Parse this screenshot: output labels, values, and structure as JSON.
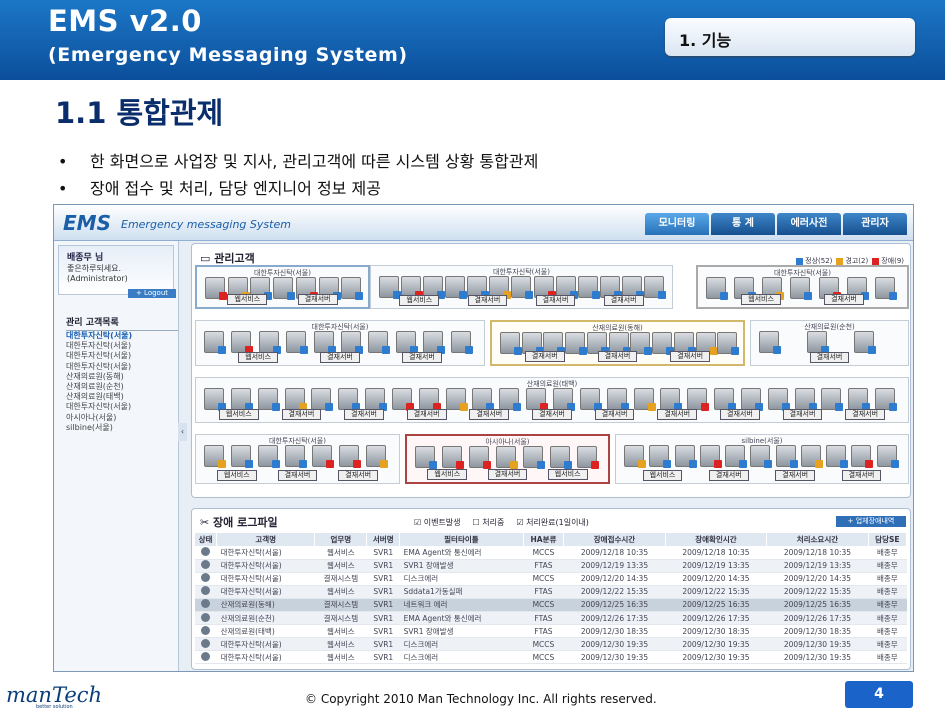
{
  "slide": {
    "title": "EMS v2.0",
    "subtitle": "(Emergency Messaging System)",
    "section": "1. 기능",
    "heading": "1.1 통합관제",
    "bullets": [
      "한 화면으로 사업장 및 지사, 관리고객에 따른 시스템 상황 통합관제",
      "장애 접수 및 처리, 담당 엔지니어 정보 제공"
    ],
    "copyright": "© Copyright 2010 Man Technology Inc. All rights reserved.",
    "page_number": "4",
    "logo": "manTech",
    "logo_sub": "better solution"
  },
  "app": {
    "logo": "EMS",
    "name": "Emergency messaging System",
    "tabs": [
      "모니터링",
      "통 계",
      "에러사전",
      "관리자"
    ],
    "user": {
      "name": "배종무 님",
      "greeting": "좋은하루되세요.",
      "role": "(Administrator)",
      "logout": "+ Logout"
    },
    "customers_title": "관리 고객목록",
    "customers": [
      "대한투자신탁(서울)",
      "대한투자신탁(서울)",
      "대한투자신탁(서울)",
      "대한투자신탁(서울)",
      "산재의료원(동해)",
      "산재의료원(순천)",
      "산재의료원(태백)",
      "대한투자신탁(서울)",
      "아시아나(서울)",
      "silbine(서울)"
    ],
    "monitor": {
      "title": "관리고객",
      "legend": [
        "정상(52)",
        "경고(2)",
        "장애(9)"
      ],
      "groups": [
        {
          "name": "대한투자신탁(서울)",
          "buttons": [
            "웹서비스",
            "결재서버"
          ]
        },
        {
          "name": "대한투자신탁(서울)",
          "buttons": [
            "웹서비스",
            "결재서버",
            "결재서버",
            "결재서버"
          ]
        },
        {
          "name": "대한투자신탁(서울)",
          "buttons": [
            "웹서비스",
            "결재서버"
          ]
        },
        {
          "name": "대한투자신탁(서울)",
          "buttons": [
            "웹서비스",
            "결재서버",
            "결재서버"
          ]
        },
        {
          "name": "산재의료원(동해)",
          "buttons": [
            "결재서버",
            "결재서버",
            "결재서버"
          ]
        },
        {
          "name": "산재의료원(순천)",
          "buttons": [
            "결재서버"
          ]
        },
        {
          "name": "산재의료원(태백)",
          "buttons": [
            "웹서비스",
            "결재서버",
            "결재서버",
            "결재서버",
            "결재서버",
            "결재서버",
            "결재서버",
            "결재서버",
            "결재서버",
            "결재서버",
            "결재서버"
          ]
        },
        {
          "name": "대한투자신탁(서울)",
          "buttons": [
            "웹서비스",
            "결재서버",
            "결재서버"
          ]
        },
        {
          "name": "아시아나(서울)",
          "buttons": [
            "웹서비스",
            "결재서버",
            "웹서비스"
          ]
        },
        {
          "name": "silbine(서울)",
          "buttons": [
            "웹서비스",
            "결재서버",
            "결재서버",
            "결재서버"
          ]
        }
      ]
    },
    "log": {
      "title": "장애 로그파일",
      "filters": [
        "이벤트발생",
        "처리중",
        "처리완료(1일이내)"
      ],
      "all_button": "+ 업체장애내역",
      "columns": [
        "상태",
        "고객명",
        "업무명",
        "서버명",
        "필터타이틀",
        "HA분류",
        "장애접수시간",
        "장애확인시간",
        "처리소요시간",
        "담당SE"
      ],
      "rows": [
        [
          "",
          "대한투자신탁(서울)",
          "웹서비스",
          "SVR1",
          "EMA Agent와 통신에러",
          "MCCS",
          "2009/12/18 10:35",
          "2009/12/18 10:35",
          "2009/12/18 10:35",
          "배종무"
        ],
        [
          "",
          "대한투자신탁(서울)",
          "웹서비스",
          "SVR1",
          "SVR1 장애발생",
          "FTAS",
          "2009/12/19 13:35",
          "2009/12/19 13:35",
          "2009/12/19 13:35",
          "배종무"
        ],
        [
          "",
          "대한투자신탁(서울)",
          "결재시스템",
          "SVR1",
          "디스크에러",
          "MCCS",
          "2009/12/20 14:35",
          "2009/12/20 14:35",
          "2009/12/20 14:35",
          "배종무"
        ],
        [
          "",
          "대한투자신탁(서울)",
          "웹서비스",
          "SVR1",
          "Sddata1가동실패",
          "FTAS",
          "2009/12/22 15:35",
          "2009/12/22 15:35",
          "2009/12/22 15:35",
          "배종무"
        ],
        [
          "",
          "산재의료원(동해)",
          "결재시스템",
          "SVR1",
          "네트워크 에러",
          "MCCS",
          "2009/12/25 16:35",
          "2009/12/25 16:35",
          "2009/12/25 16:35",
          "배종무"
        ],
        [
          "",
          "산재의료원(순천)",
          "결재시스템",
          "SVR1",
          "EMA Agent와 통신에러",
          "FTAS",
          "2009/12/26 17:35",
          "2009/12/26 17:35",
          "2009/12/26 17:35",
          "배종무"
        ],
        [
          "",
          "산재의료원(태백)",
          "웹서비스",
          "SVR1",
          "SVR1 장애발생",
          "FTAS",
          "2009/12/30 18:35",
          "2009/12/30 18:35",
          "2009/12/30 18:35",
          "배종무"
        ],
        [
          "",
          "대한투자신탁(서울)",
          "웹서비스",
          "SVR1",
          "디스크에러",
          "MCCS",
          "2009/12/30 19:35",
          "2009/12/30 19:35",
          "2009/12/30 19:35",
          "배종무"
        ],
        [
          "",
          "대한투자신탁(서울)",
          "웹서비스",
          "SVR1",
          "디스크에러",
          "MCCS",
          "2009/12/30 19:35",
          "2009/12/30 19:35",
          "2009/12/30 19:35",
          "배종무"
        ]
      ]
    }
  }
}
